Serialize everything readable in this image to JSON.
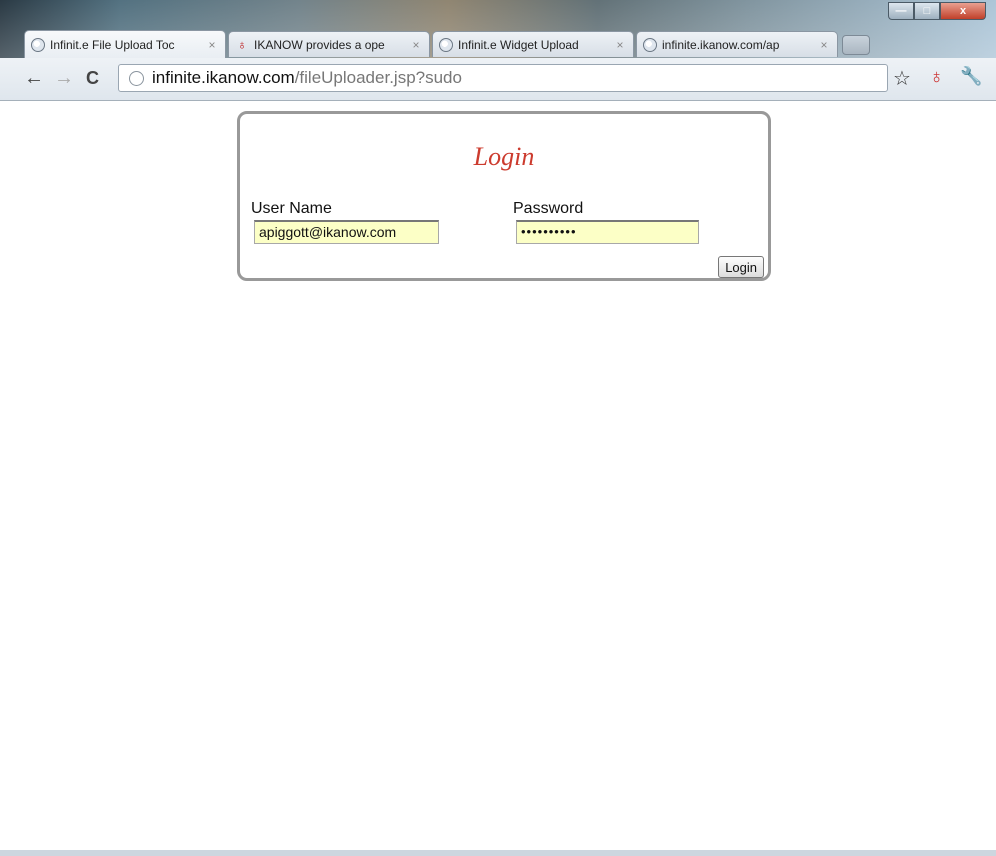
{
  "tabs": [
    {
      "label": "Infinit.e File Upload Toc",
      "icon": "globe-icon",
      "active": true
    },
    {
      "label": "IKANOW provides a ope",
      "icon": "ikanow-bulb-icon",
      "active": false
    },
    {
      "label": "Infinit.e Widget Upload",
      "icon": "globe-icon",
      "active": false
    },
    {
      "label": "infinite.ikanow.com/ap",
      "icon": "globe-icon",
      "active": false
    }
  ],
  "tab_close": "×",
  "window_controls": {
    "minimize": "—",
    "maximize": "□",
    "close": "x"
  },
  "nav": {
    "back": "←",
    "forward": "→",
    "reload": "C"
  },
  "address": {
    "host": "infinite.ikanow.com",
    "path": "/fileUploader.jsp?sudo"
  },
  "toolbar_icons": {
    "bookmark": "☆",
    "extension": "♁",
    "wrench": "🔧"
  },
  "login": {
    "title": "Login",
    "username_label": "User Name",
    "username_value": "apiggott@ikanow.com",
    "password_label": "Password",
    "password_value": "••••••••••",
    "button_label": "Login"
  },
  "colors": {
    "title_red": "#cc3b2e",
    "input_bg": "#fcffc6"
  }
}
